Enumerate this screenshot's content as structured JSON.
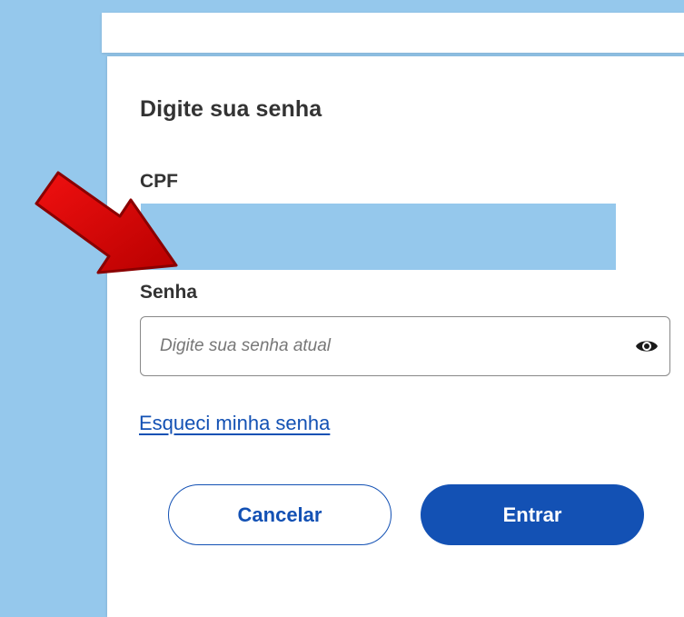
{
  "form": {
    "title": "Digite sua senha",
    "cpf_label": "CPF",
    "password_label": "Senha",
    "password_placeholder": "Digite sua senha atual",
    "password_value": "",
    "forgot_link": "Esqueci minha senha"
  },
  "buttons": {
    "cancel_label": "Cancelar",
    "submit_label": "Entrar"
  },
  "icons": {
    "password_toggle": "eye-icon",
    "annotation": "red-arrow-icon"
  },
  "colors": {
    "background": "#95c8ec",
    "primary": "#1351b4",
    "annotation": "#d40000",
    "text": "#333333"
  }
}
